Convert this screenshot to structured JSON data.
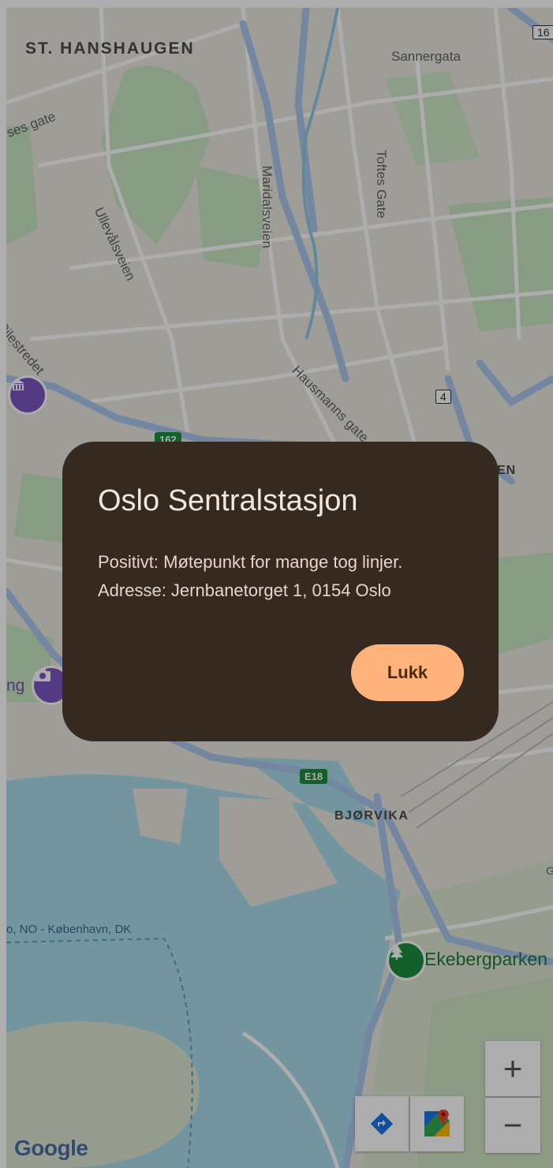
{
  "map": {
    "labels": {
      "st_hanshaugen": "ST. HANSHAUGEN",
      "sannergata": "Sannergata",
      "toftes_gate": "Toftes Gate",
      "maridalsveien": "Maridalsveien",
      "ullevalsveien": "Ullevålsveien",
      "pilestredet": "Pilestredet",
      "hausmanns_gate": "Hausmanns gate",
      "ses_gate": "ses gate",
      "en_fragment": "EN",
      "ng_fragment": "ng",
      "bjorvika": "BJØRVIKA",
      "ferry": "o, NO - København, DK",
      "ekebergparken": "Ekebergparken",
      "g_fragment": "G"
    },
    "shields": {
      "route_162": "162",
      "route_e18": "E18",
      "route_4": "4",
      "route_16": "16"
    },
    "poi_icons": [
      "museum-icon",
      "camera-icon",
      "park-tree-icon"
    ],
    "attribution": "Google"
  },
  "dialog": {
    "title": "Oslo Sentralstasjon",
    "line1": "Positivt: Møtepunkt for mange tog linjer.",
    "line2": "Adresse: Jernbanetorget 1, 0154 Oslo",
    "close_label": "Lukk"
  },
  "controls": {
    "zoom_in": "+",
    "zoom_out": "−",
    "icons": [
      "directions-icon",
      "google-maps-icon"
    ]
  },
  "colors": {
    "dialog_bg": "#362920",
    "button_bg": "#ffb27a",
    "water": "#a8dcea",
    "park": "#c8e6c0",
    "road_main": "#aac8ec"
  }
}
